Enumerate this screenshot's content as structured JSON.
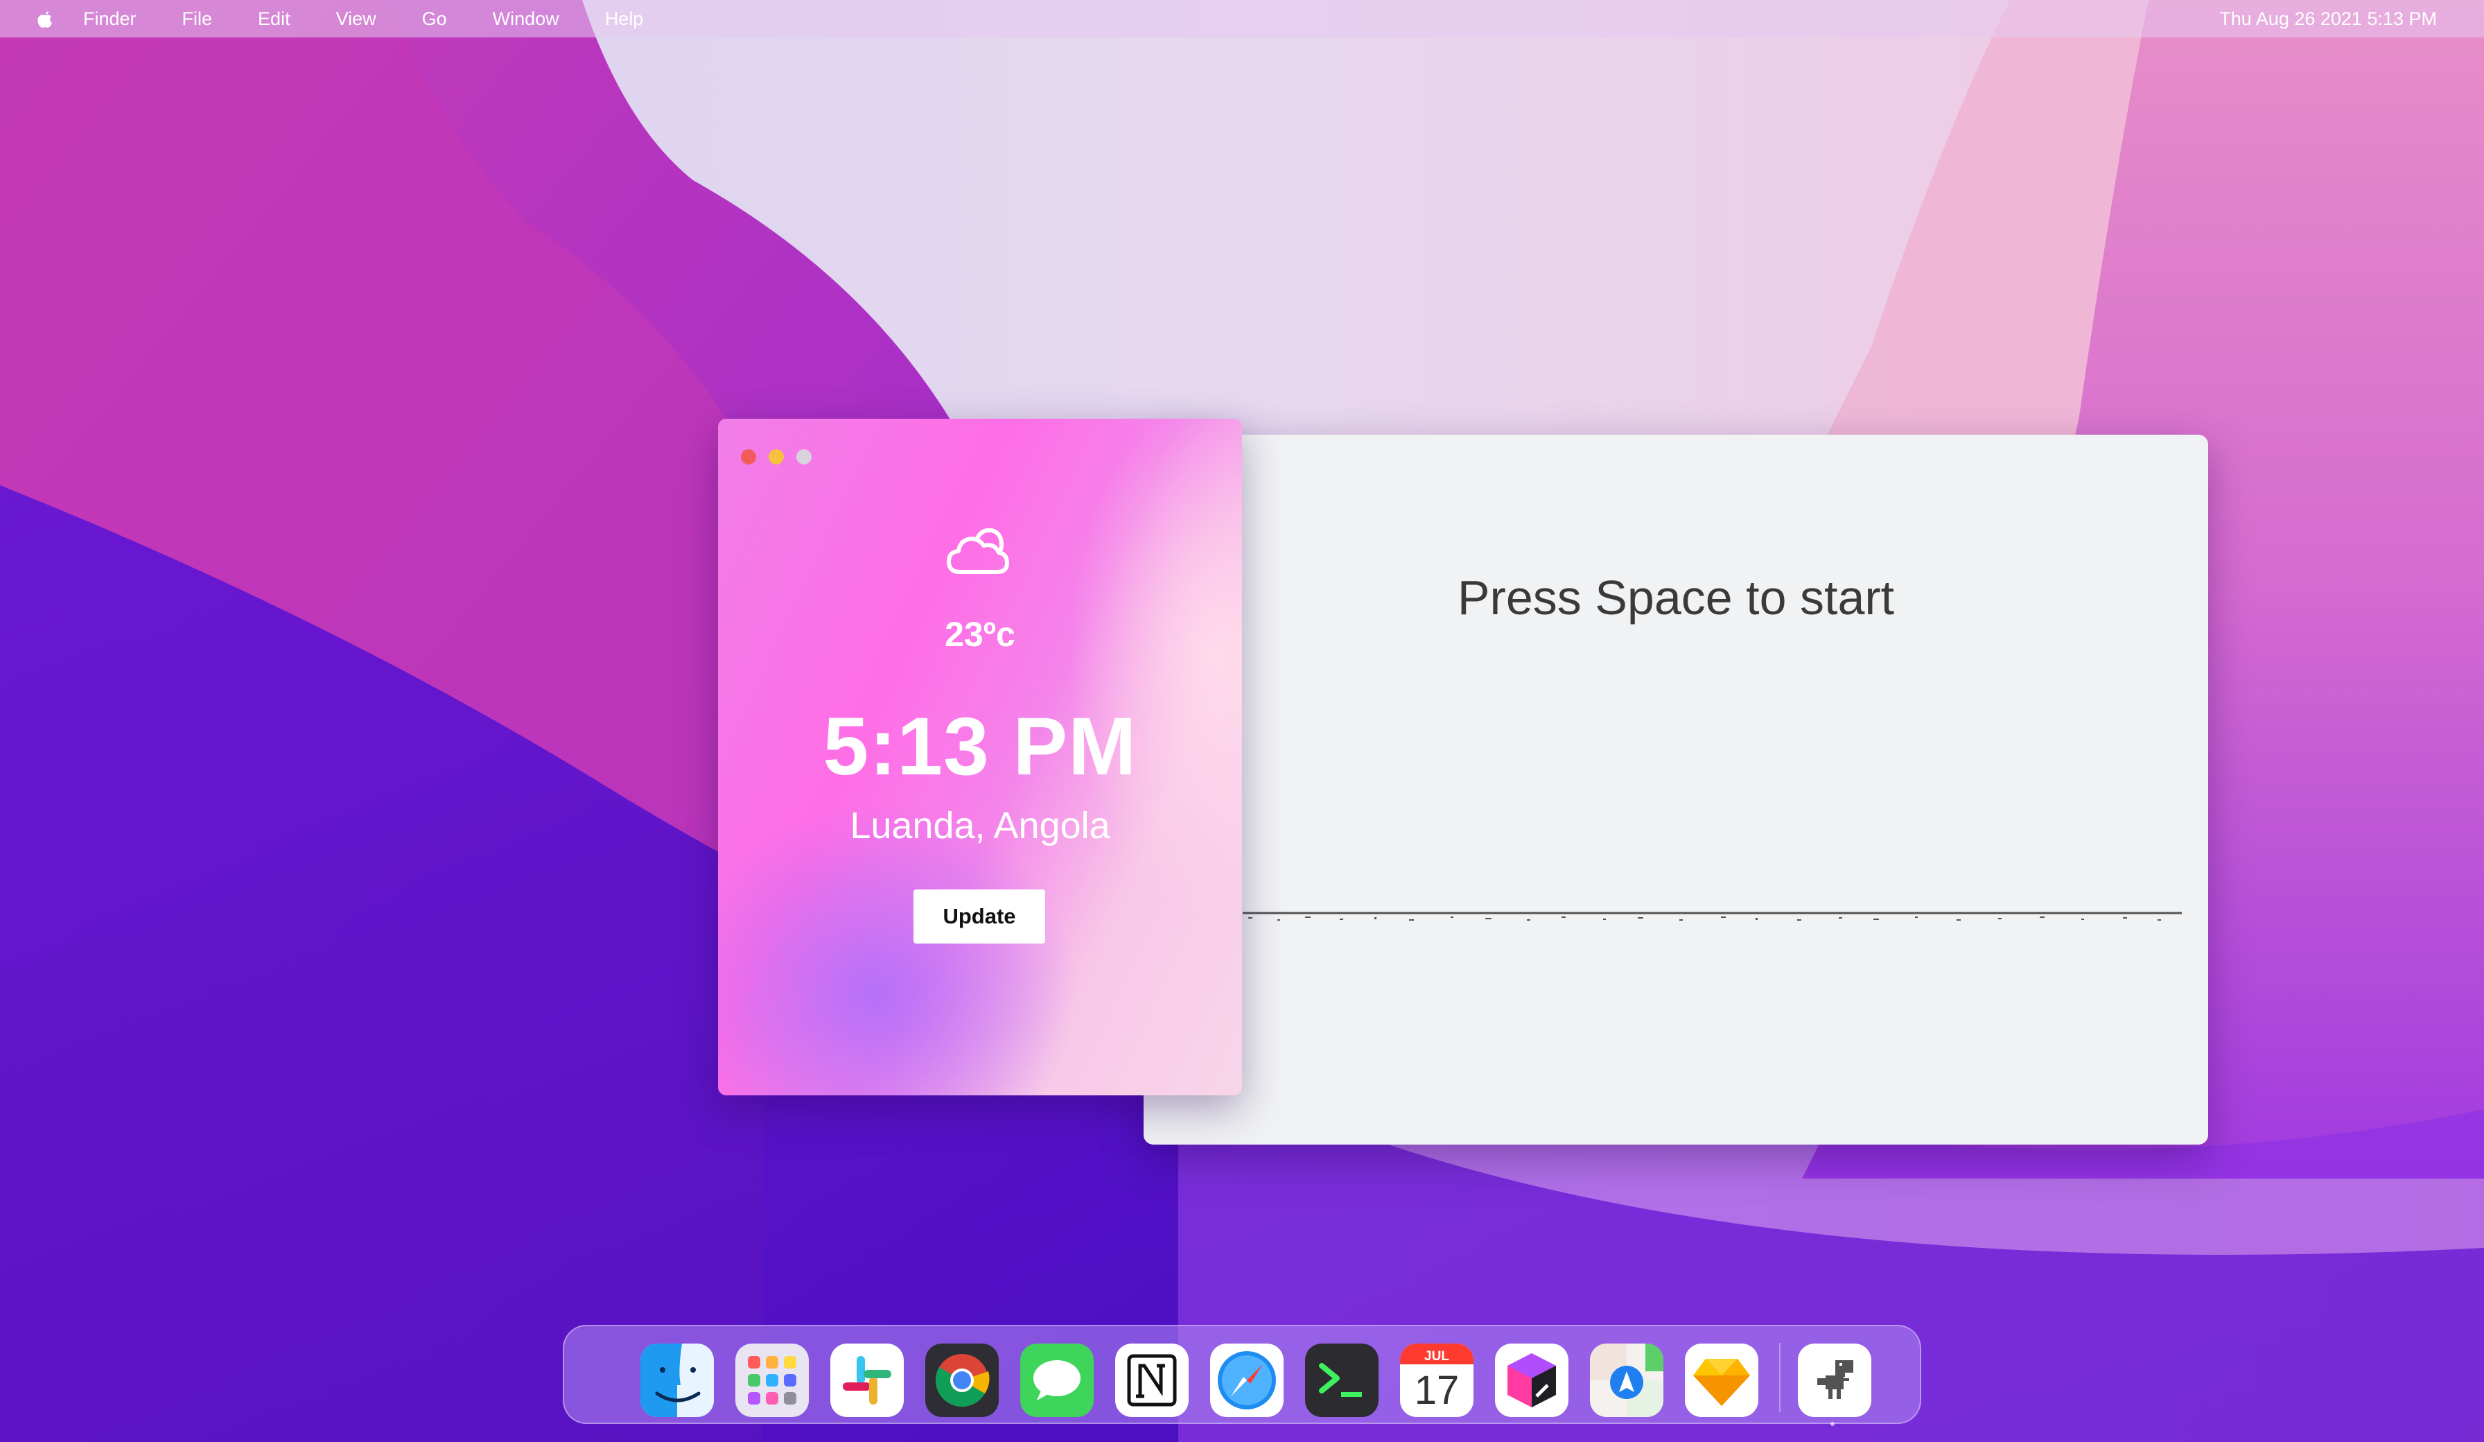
{
  "menubar": {
    "items": [
      "Finder",
      "File",
      "Edit",
      "View",
      "Go",
      "Window",
      "Help"
    ],
    "clock": "Thu Aug 26 2021 5:13 PM"
  },
  "weather": {
    "temperature": "23ºc",
    "time": "5:13 PM",
    "location": "Luanda, Angola",
    "update_label": "Update",
    "condition_icon": "cloud-icon"
  },
  "game": {
    "prompt": "Press Space to start"
  },
  "dock": {
    "apps": [
      "Finder",
      "Launchpad",
      "Slack",
      "Google Chrome",
      "Messages",
      "Notion",
      "Safari",
      "Terminal",
      "Calendar",
      "Affinity",
      "Instruments",
      "Sketch",
      "Dino Game"
    ],
    "calendar_month": "JUL",
    "calendar_day": "17"
  },
  "colors": {
    "accent_pink": "#ff6ee6",
    "close": "#f25c58",
    "minimize": "#f6c23d",
    "game_bg": "#f1f2f4"
  }
}
